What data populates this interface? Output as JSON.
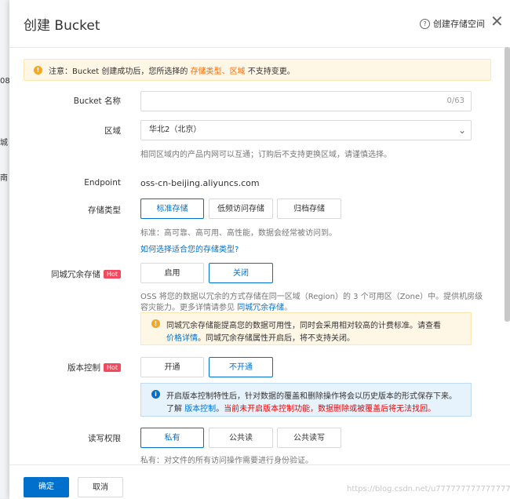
{
  "background": {
    "fragments": [
      "08",
      "城",
      "南"
    ]
  },
  "header": {
    "title": "创建 Bucket",
    "help_label": "创建存储空间",
    "close": "✕"
  },
  "notice": {
    "prefix": "注意：Bucket 创建成功后，您所选择的 ",
    "highlight1": "存储类型",
    "sep": "、",
    "highlight2": "区域",
    "suffix": " 不支持变更。"
  },
  "name_field": {
    "label": "Bucket 名称",
    "value": "",
    "counter": "0/63"
  },
  "region": {
    "label": "区域",
    "value": "华北2（北京）",
    "hint": "相同区域内的产品内网可以互通；订购后不支持更换区域，请谨慎选择。"
  },
  "endpoint": {
    "label": "Endpoint",
    "value": "oss-cn-beijing.aliyuncs.com"
  },
  "storage_class": {
    "label": "存储类型",
    "options": [
      "标准存储",
      "低频访问存储",
      "归档存储"
    ],
    "selected": 0,
    "hint": "标准：高可靠、高可用、高性能，数据会经常被访问到。",
    "link": "如何选择适合您的存储类型?"
  },
  "redundancy": {
    "label": "同城冗余存储",
    "badge": "Hot",
    "options": [
      "启用",
      "关闭"
    ],
    "selected": 1,
    "desc_line1": "OSS 将您的数据以冗余的方式存储在同一区域（Region）的 3 个可用区（Zone）中。提供机房级",
    "desc_line2_prefix": "容灾能力。更多详情请参见 ",
    "desc_link": "同城冗余存储",
    "desc_line2_suffix": "。",
    "warn_line1": "同城冗余存储能提高您的数据可用性，同时会采用相对较高的计费标准。请查看",
    "warn_link": "价格详情",
    "warn_line2_suffix": "。同城冗余存储属性开启后，将不支持关闭。"
  },
  "versioning": {
    "label": "版本控制",
    "badge": "Hot",
    "options": [
      "开通",
      "不开通"
    ],
    "selected": 1,
    "info_line1": "开启版本控制特性后，针对数据的覆盖和删除操作将会以历史版本的形式保存下来。",
    "info_line2_prefix": "了解 ",
    "info_link": "版本控制",
    "info_line2_mid": "。",
    "info_warning": "当前未开启版本控制功能，数据删除或被覆盖后将无法找回。"
  },
  "acl": {
    "label": "读写权限",
    "options": [
      "私有",
      "公共读",
      "公共读写"
    ],
    "selected": 0,
    "hint": "私有：对文件的所有访问操作需要进行身份验证。"
  },
  "footer": {
    "confirm": "确定",
    "cancel": "取消",
    "watermark": "https://blog.csdn.net/u777777777777777"
  },
  "colors": {
    "primary": "#0070cc",
    "accent": "#ff6a00",
    "hot_badge": "#f2495e"
  }
}
